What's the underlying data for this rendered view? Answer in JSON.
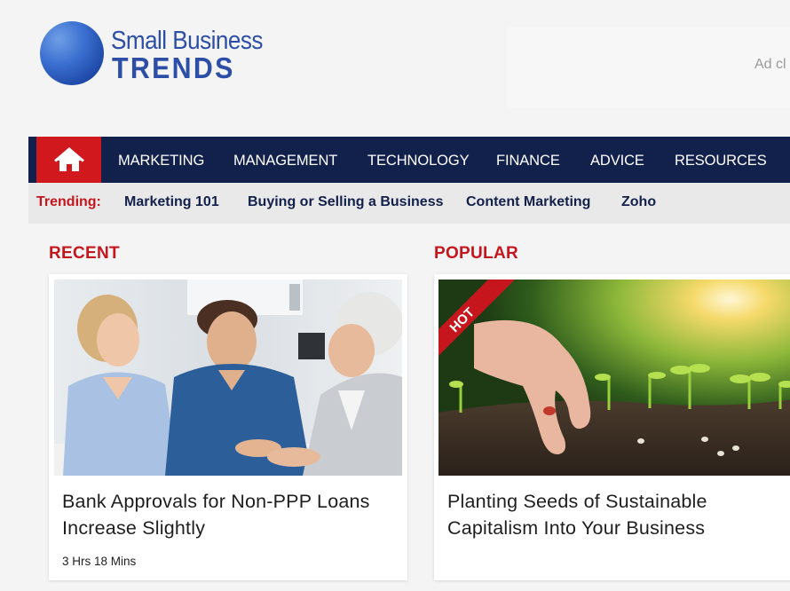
{
  "brand": {
    "line1": "Small Business",
    "line2": "TRENDS",
    "logo_color": "#2d4ea6"
  },
  "ad": {
    "text": "Ad cl"
  },
  "nav": {
    "home_icon": "home-icon",
    "items": [
      {
        "label": "MARKETING"
      },
      {
        "label": "MANAGEMENT"
      },
      {
        "label": "TECHNOLOGY"
      },
      {
        "label": "FINANCE"
      },
      {
        "label": "ADVICE"
      },
      {
        "label": "RESOURCES"
      }
    ],
    "bg_color": "#12214c",
    "home_color": "#d0181d"
  },
  "trending": {
    "label": "Trending:",
    "links": [
      {
        "label": "Marketing 101"
      },
      {
        "label": "Buying or Selling a Business"
      },
      {
        "label": "Content Marketing"
      },
      {
        "label": "Zoho"
      }
    ]
  },
  "recent": {
    "heading": "RECENT",
    "card": {
      "title_line1": "Bank Approvals for Non-PPP Loans",
      "title_line2": "Increase Slightly",
      "time": "3 Hrs 18 Mins"
    }
  },
  "popular": {
    "heading": "POPULAR",
    "card": {
      "badge": "HOT",
      "title_line1": "Planting Seeds of Sustainable",
      "title_line2": "Capitalism Into Your Business"
    }
  },
  "accent_color": "#c4161c"
}
